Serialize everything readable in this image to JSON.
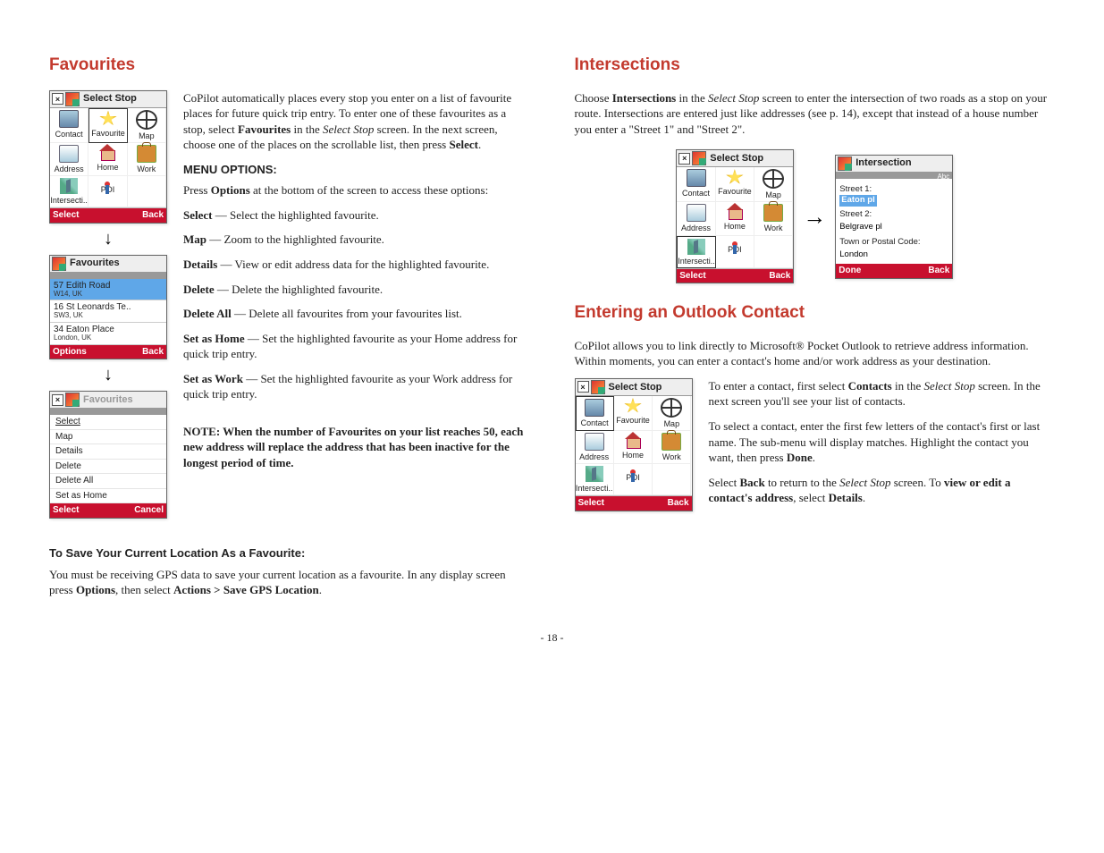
{
  "page_number": "- 18 -",
  "left": {
    "heading": "Favourites",
    "intro": "CoPilot automatically places every stop you enter on a list of favourite places for future quick trip entry.  To enter one of these favourites as a stop, select Favourites in the Select Stop screen.  In the next screen, choose one of the places on the scrollable list, then press Select.",
    "menu_heading": "MENU OPTIONS:",
    "menu_intro": "Press Options at the bottom of the screen to access these options:",
    "options": [
      {
        "term": "Select",
        "desc": " — Select the highlighted favourite."
      },
      {
        "term": "Map",
        "desc": " — Zoom to the highlighted favourite."
      },
      {
        "term": "Details",
        "desc": " — View or edit address data for the highlighted favourite."
      },
      {
        "term": "Delete",
        "desc": " — Delete the highlighted favourite."
      },
      {
        "term": "Delete All",
        "desc": " — Delete all favourites from your favourites list."
      },
      {
        "term": "Set as Home",
        "desc": " — Set the highlighted favourite as your Home address for quick trip entry."
      },
      {
        "term": "Set as Work",
        "desc": " — Set the highlighted favourite as your Work address for quick trip entry."
      }
    ],
    "note": "NOTE:  When the number of Favourites on your list reaches 50, each new address will replace the address that has been inactive for the longest period of time.",
    "save_heading": "To Save Your Current Location As a Favourite:",
    "save_body": "You must be receiving GPS data to save your current location as a favourite.  In any display screen press Options, then select Actions > Save GPS Location.",
    "screen1": {
      "title": "Select Stop",
      "cells": [
        "Contact",
        "Favourite",
        "Map",
        "Address",
        "Home",
        "Work",
        "Intersecti..",
        "POI",
        ""
      ],
      "soft_left": "Select",
      "soft_right": "Back"
    },
    "screen2": {
      "title": "Favourites",
      "items": [
        {
          "l1": "57 Edith Road",
          "l2": "W14, UK"
        },
        {
          "l1": "16 St Leonards Te..",
          "l2": "SW3, UK"
        },
        {
          "l1": "34 Eaton Place",
          "l2": "London, UK"
        }
      ],
      "soft_left": "Options",
      "soft_right": "Back"
    },
    "screen3": {
      "title": "Favourites",
      "menu": [
        "Select",
        "Map",
        "Details",
        "Delete",
        "Delete All",
        "Set as Home"
      ],
      "soft_left": "Select",
      "soft_right": "Cancel"
    }
  },
  "right": {
    "heading1": "Intersections",
    "para1": "Choose Intersections in the Select Stop screen to enter the intersection of two roads as a stop on your route.  Intersections are entered just like addresses (see p. 14), except that instead of a house number you enter a \"Street 1\" and \"Street 2\".",
    "screenA": {
      "title": "Select Stop",
      "cells": [
        "Contact",
        "Favourite",
        "Map",
        "Address",
        "Home",
        "Work",
        "Intersecti..",
        "POI",
        ""
      ],
      "soft_left": "Select",
      "soft_right": "Back"
    },
    "screenB": {
      "title": "Intersection",
      "abc": "Abc",
      "s1_label": "Street 1:",
      "s1_val": "Eaton pl",
      "s2_label": "Street 2:",
      "s2_val": "Belgrave pl",
      "town_label": "Town or Postal Code:",
      "town_val": "London",
      "soft_left": "Done",
      "soft_right": "Back"
    },
    "heading2": "Entering an Outlook Contact",
    "para2": "CoPilot allows you to link directly to Microsoft® Pocket Outlook to retrieve address information.  Within moments, you can enter a contact's home and/or work address as your destination.",
    "contact_p1": "To enter a contact, first select Contacts in the Select Stop screen.  In the next screen you'll see your list of contacts.",
    "contact_p2": "To select a contact, enter the first few letters of the contact's first or last name.  The sub-menu will display matches.  Highlight the contact you want, then press Done.",
    "contact_p3": "Select Back to return to the Select Stop screen.  To view or edit a contact's address, select Details.",
    "screenC": {
      "title": "Select Stop",
      "cells": [
        "Contact",
        "Favourite",
        "Map",
        "Address",
        "Home",
        "Work",
        "Intersecti..",
        "POI",
        ""
      ],
      "soft_left": "Select",
      "soft_right": "Back"
    }
  }
}
